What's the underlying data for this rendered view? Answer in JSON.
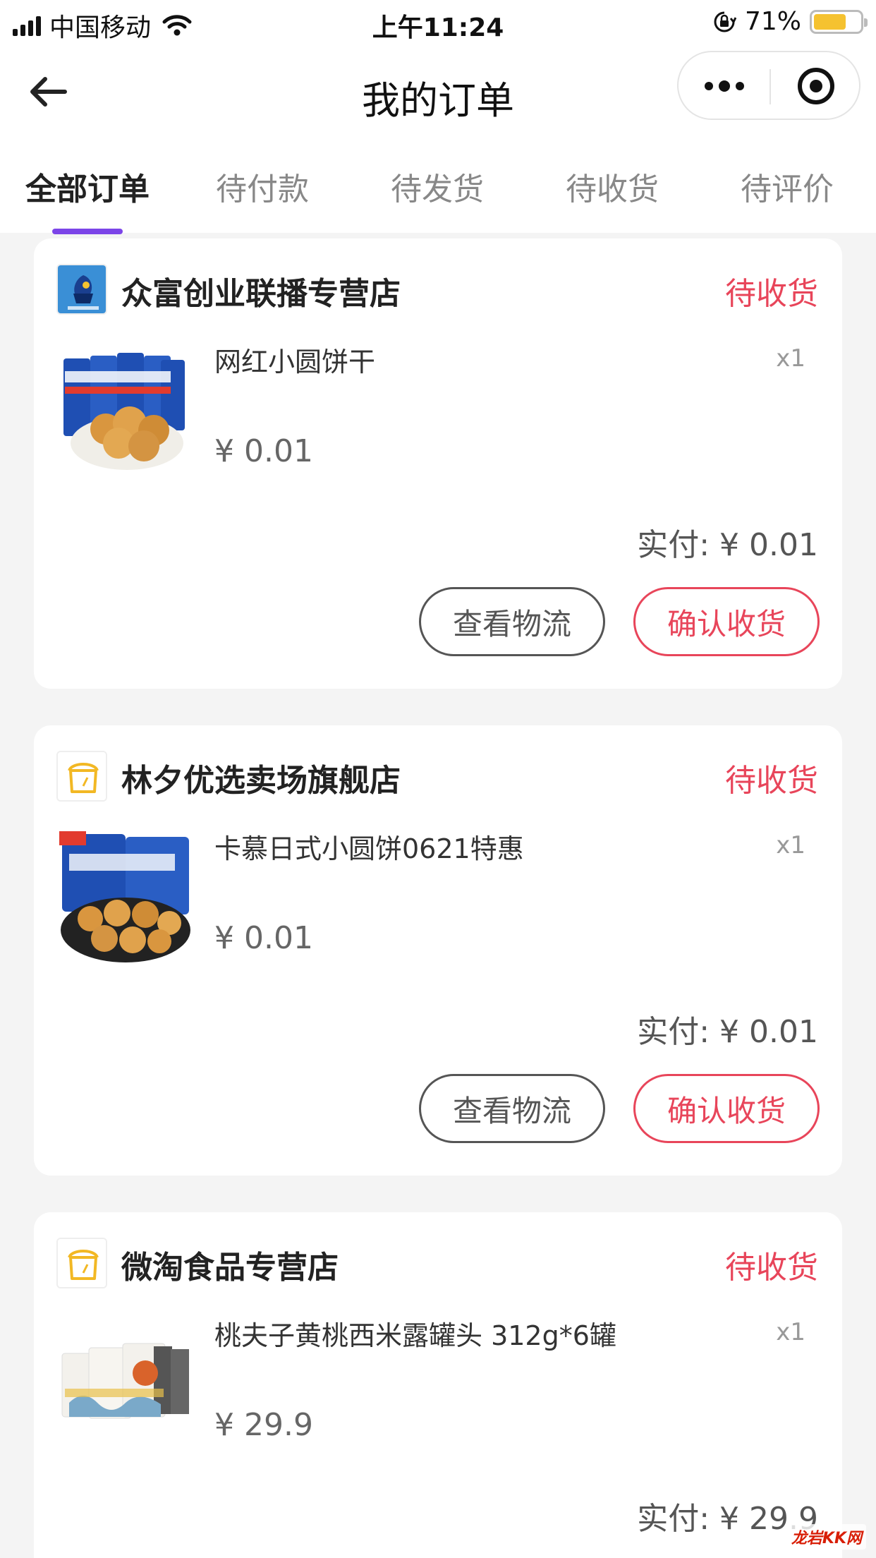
{
  "status_bar": {
    "carrier": "中国移动",
    "time": "上午11:24",
    "battery_percent": "71%",
    "battery_level": 0.71
  },
  "nav": {
    "title": "我的订单"
  },
  "tabs": [
    {
      "label": "全部订单",
      "active": true
    },
    {
      "label": "待付款",
      "active": false
    },
    {
      "label": "待发货",
      "active": false
    },
    {
      "label": "待收货",
      "active": false
    },
    {
      "label": "待评价",
      "active": false
    }
  ],
  "orders": [
    {
      "store_name": "众富创业联播专营店",
      "status": "待收货",
      "product_name": "网红小圆饼干",
      "quantity": "x1",
      "price": "¥ 0.01",
      "paid": "实付: ¥ 0.01",
      "logistics_label": "查看物流",
      "confirm_label": "确认收货"
    },
    {
      "store_name": "林夕优选卖场旗舰店",
      "status": "待收货",
      "product_name": "卡慕日式小圆饼0621特惠",
      "quantity": "x1",
      "price": "¥ 0.01",
      "paid": "实付: ¥ 0.01",
      "logistics_label": "查看物流",
      "confirm_label": "确认收货"
    },
    {
      "store_name": "微淘食品专营店",
      "status": "待收货",
      "product_name": "桃夫子黄桃西米露罐头 312g*6罐",
      "quantity": "x1",
      "price": "¥ 29.9",
      "paid": "实付: ¥ 29.9"
    }
  ],
  "watermark": "龙岩KK网",
  "colors": {
    "accent_status": "#e8455a",
    "tab_indicator": "#7c45e8",
    "battery": "#f5c230"
  },
  "icons": [
    "signal-icon",
    "wifi-icon",
    "orientation-lock-icon",
    "battery-icon",
    "back-arrow-icon",
    "more-icon",
    "close-target-icon"
  ]
}
